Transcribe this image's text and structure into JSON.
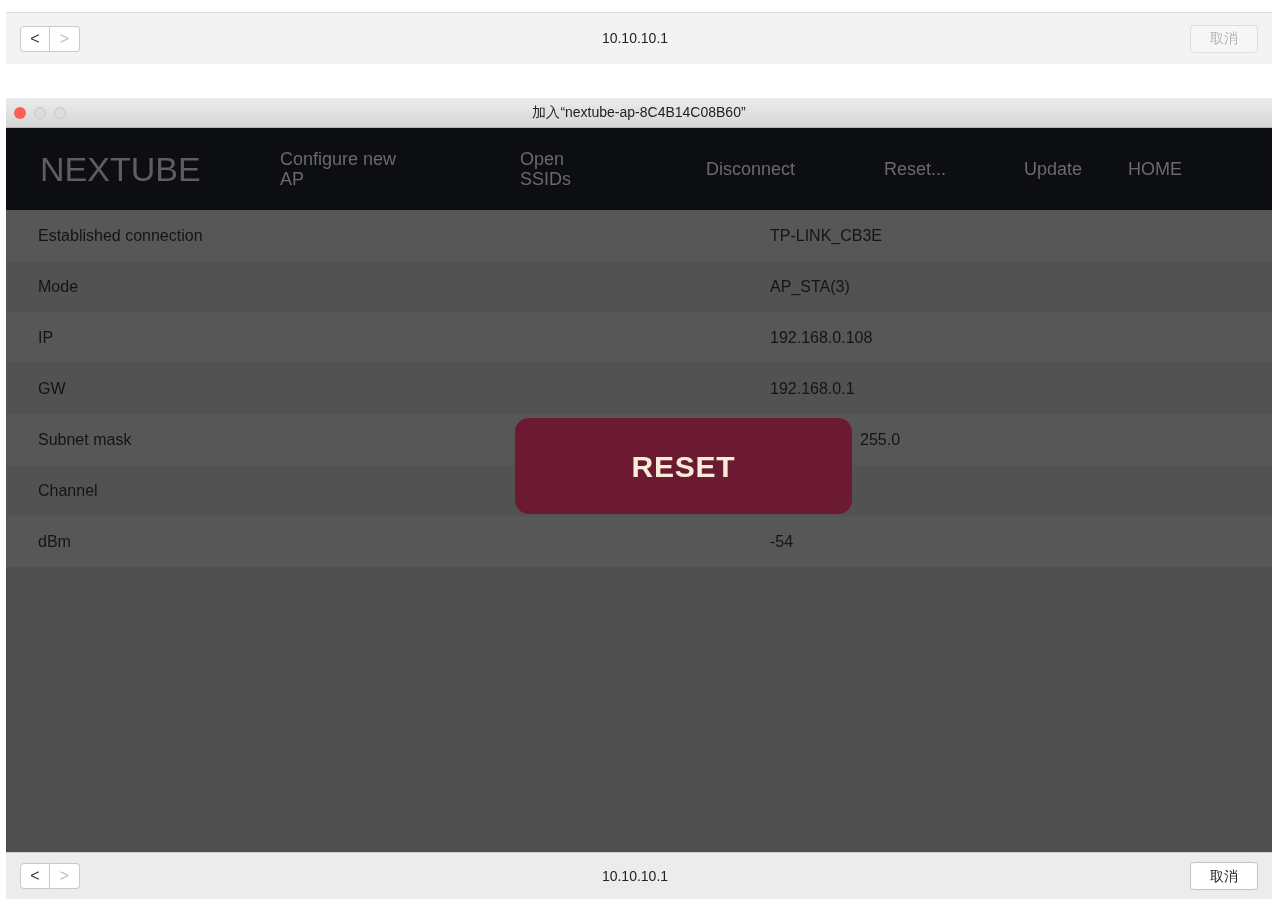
{
  "top_bar": {
    "back": {
      "label": "<",
      "disabled": false
    },
    "forward": {
      "label": ">",
      "disabled": true
    },
    "url": "10.10.10.1",
    "cancel": {
      "label": "取消",
      "disabled": true
    }
  },
  "window": {
    "title": "加入“nextube-ap-8C4B14C08B60”"
  },
  "nav": {
    "brand": "NEXTUBE",
    "items": [
      {
        "label": "Configure new AP"
      },
      {
        "label": "Open SSIDs"
      },
      {
        "label": "Disconnect"
      },
      {
        "label": "Reset..."
      },
      {
        "label": "Update"
      },
      {
        "label": "HOME"
      }
    ]
  },
  "rows": [
    {
      "label": "Established connection",
      "value": "TP-LINK_CB3E"
    },
    {
      "label": "Mode",
      "value": "AP_STA(3)"
    },
    {
      "label": "IP",
      "value": "192.168.0.108"
    },
    {
      "label": "GW",
      "value": "192.168.0.1"
    },
    {
      "label": "Subnet mask",
      "value": "255.0"
    },
    {
      "label": "Channel"
    },
    {
      "label": "dBm",
      "value": "-54"
    }
  ],
  "reset_button": "RESET",
  "bottom_bar": {
    "back": {
      "label": "<",
      "disabled": false
    },
    "forward": {
      "label": ">",
      "disabled": true
    },
    "url": "10.10.10.1",
    "cancel": {
      "label": "取消",
      "disabled": false
    }
  }
}
